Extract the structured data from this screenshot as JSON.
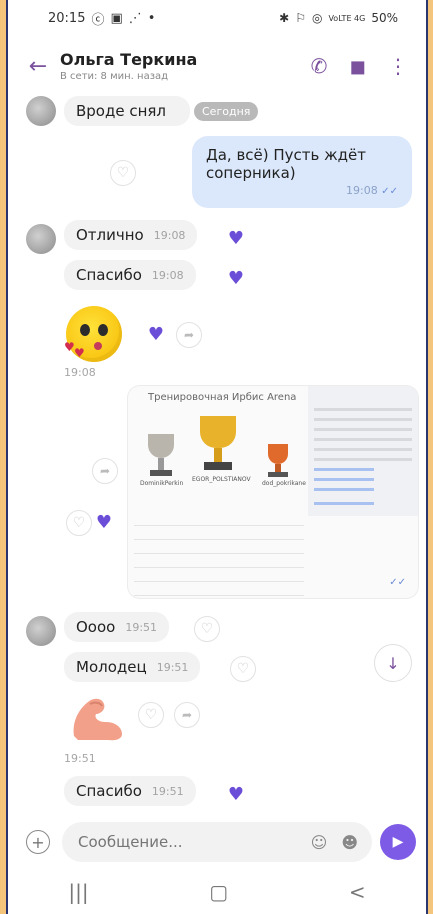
{
  "status_bar": {
    "time": "20:15",
    "left_icons": [
      "ⓒ",
      "▣",
      "⋰",
      "•"
    ],
    "right_icons": [
      "✱",
      "⚐",
      "◎"
    ],
    "network": "VoLTE 4G",
    "battery": "50%"
  },
  "header": {
    "back_icon": "←",
    "contact_name": "Ольга Теркина",
    "contact_status": "В сети: 8 мин. назад",
    "call_icon": "✆",
    "video_icon": "◼",
    "more_icon": "⋮"
  },
  "messages": [
    {
      "id": "m1",
      "text": "Вроде снял",
      "date_badge": "Сегодня"
    },
    {
      "id": "m2",
      "text": "Да, всё) Пусть ждёт соперника)",
      "time": "19:08",
      "ticks": "✓✓"
    },
    {
      "id": "m3",
      "text": "Отлично",
      "time": "19:08"
    },
    {
      "id": "m4",
      "text": "Спасибо",
      "time": "19:08"
    },
    {
      "id": "m5",
      "time": "19:08"
    },
    {
      "id": "m6",
      "text": "Оооо",
      "time": "19:51"
    },
    {
      "id": "m7",
      "text": "Молодец",
      "time": "19:51"
    },
    {
      "id": "m8",
      "time": "19:51"
    },
    {
      "id": "m9",
      "text": "Спасибо",
      "time": "19:51"
    }
  ],
  "image_message": {
    "title": "Тренировочная Ирбис Arena",
    "labels": [
      "DominikPerkin",
      "EGOR_POLSTIANOV",
      "dod_pokrikane"
    ],
    "ticks": "✓✓"
  },
  "compose": {
    "plus_icon": "+",
    "placeholder": "Сообщение...",
    "emoji_icon": "☺",
    "sticker_icon": "☻",
    "send_icon": "▶"
  },
  "navbar": {
    "recents": "|||",
    "home": "▢",
    "back": "<"
  },
  "scroll_down_icon": "↓",
  "colors": {
    "accent": "#7b519d",
    "heart": "#6b4ed8",
    "out_bubble": "#dbe8fb"
  }
}
